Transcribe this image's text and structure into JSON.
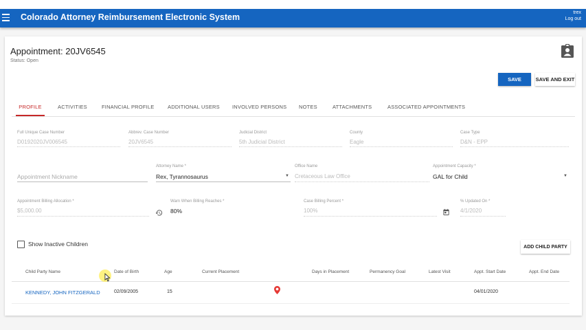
{
  "app": {
    "title": "Colorado Attorney Reimbursement Electronic System",
    "user": "trex",
    "logout": "Log out"
  },
  "header": {
    "title": "Appointment: 20JV6545",
    "status": "Status: Open",
    "save_label": "SAVE",
    "save_exit_label": "SAVE AND EXIT"
  },
  "tabs": [
    {
      "label": "PROFILE",
      "active": true
    },
    {
      "label": "ACTIVITIES"
    },
    {
      "label": "FINANCIAL PROFILE"
    },
    {
      "label": "ADDITIONAL USERS"
    },
    {
      "label": "INVOLVED PERSONS"
    },
    {
      "label": "NOTES"
    },
    {
      "label": "ATTACHMENTS"
    },
    {
      "label": "ASSOCIATED APPOINTMENTS"
    }
  ],
  "case_info": {
    "full_case_label": "Full Unique Case Number",
    "full_case_value": "D0192020JV006545",
    "abbrev_label": "Abbrev. Case Number",
    "abbrev_value": "20JV6545",
    "district_label": "Judicial District",
    "district_value": "5th Judicial District",
    "county_label": "County",
    "county_value": "Eagle",
    "case_type_label": "Case Type",
    "case_type_value": "D&N - EPP"
  },
  "appointment": {
    "nickname_placeholder": "Appointment Nickname",
    "attorney_label": "Attorney Name *",
    "attorney_value": "Rex, Tyrannosaurus",
    "office_label": "Office Name",
    "office_value": "Cretaceous Law Office",
    "capacity_label": "Appointment Capacity *",
    "capacity_value": "GAL for Child"
  },
  "billing": {
    "allocation_label": "Appointment Billing Allocation *",
    "allocation_value": "$5,000.00",
    "warn_label": "Warn When Billing Reaches *",
    "warn_value": "80%",
    "percent_label": "Case Billing Percent *",
    "percent_value": "100%",
    "updated_label": "% Updated On *",
    "updated_value": "4/1/2020"
  },
  "children": {
    "show_inactive_label": "Show Inactive Children",
    "add_label": "ADD CHILD PARTY",
    "columns": [
      "Child Party Name",
      "Date of Birth",
      "Age",
      "Current Placement",
      "Days in Placement",
      "Permanency Goal",
      "Latest Visit",
      "Appt. Start Date",
      "Appt. End Date"
    ],
    "rows": [
      {
        "name": "KENNEDY, JOHN FITZGERALD",
        "dob": "02/09/2005",
        "age": "15",
        "start": "04/01/2020"
      }
    ]
  },
  "colors": {
    "primary": "#1565c0",
    "active_tab": "#c62828",
    "placement_pin": "#e53935"
  }
}
